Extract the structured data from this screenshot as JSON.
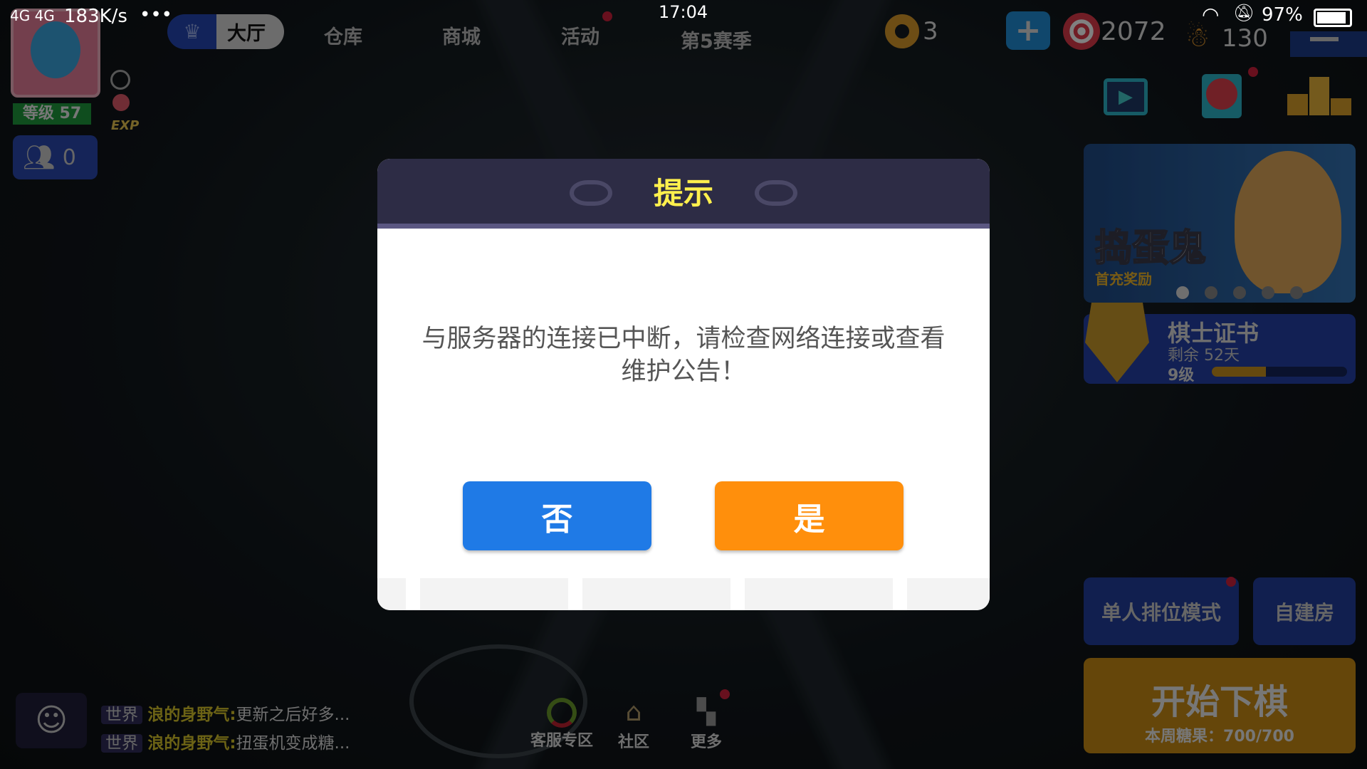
{
  "status_bar": {
    "network": "4G 4G",
    "speed": "183K/s",
    "more": "•••",
    "time": "17:04",
    "battery": "97%"
  },
  "nav": {
    "tabs": [
      {
        "label": "大厅",
        "active": true
      },
      {
        "label": "仓库"
      },
      {
        "label": "商城"
      },
      {
        "label": "活动",
        "badge": true
      },
      {
        "label": "第5赛季"
      }
    ]
  },
  "currencies": {
    "donut": "3",
    "candy": "2072",
    "gingerbread": "130"
  },
  "player": {
    "level": "等级 57",
    "exp_label": "EXP",
    "friends_count": "0"
  },
  "banner": {
    "title": "捣蛋鬼",
    "subtitle": "首充奖励",
    "dots": 5,
    "active_dot": 0
  },
  "certificate": {
    "title": "棋士证书",
    "remaining": "剩余 52天",
    "level": "9级",
    "progress": 0.4
  },
  "modes": {
    "ranked": "单人排位模式",
    "custom": "自建房",
    "start": "开始下棋",
    "weekly_candy": "本周糖果：700/700"
  },
  "chat": [
    {
      "channel": "世界",
      "user": "浪的身野气:",
      "text": "更新之后好多..."
    },
    {
      "channel": "世界",
      "user": "浪的身野气:",
      "text": "扭蛋机变成糖..."
    }
  ],
  "bottom_nav": [
    {
      "label": "客服专区",
      "icon": "support-icon"
    },
    {
      "label": "社区",
      "icon": "community-icon"
    },
    {
      "label": "更多",
      "icon": "more-icon",
      "badge": true
    }
  ],
  "dialog": {
    "title": "提示",
    "message": "与服务器的连接已中断，请检查网络连接或查看维护公告！",
    "no": "否",
    "yes": "是"
  },
  "colors": {
    "dialog_title": "#fff04d",
    "no_button": "#1f7ae6",
    "yes_button": "#ff8f0c",
    "header": "#2d2c45"
  }
}
